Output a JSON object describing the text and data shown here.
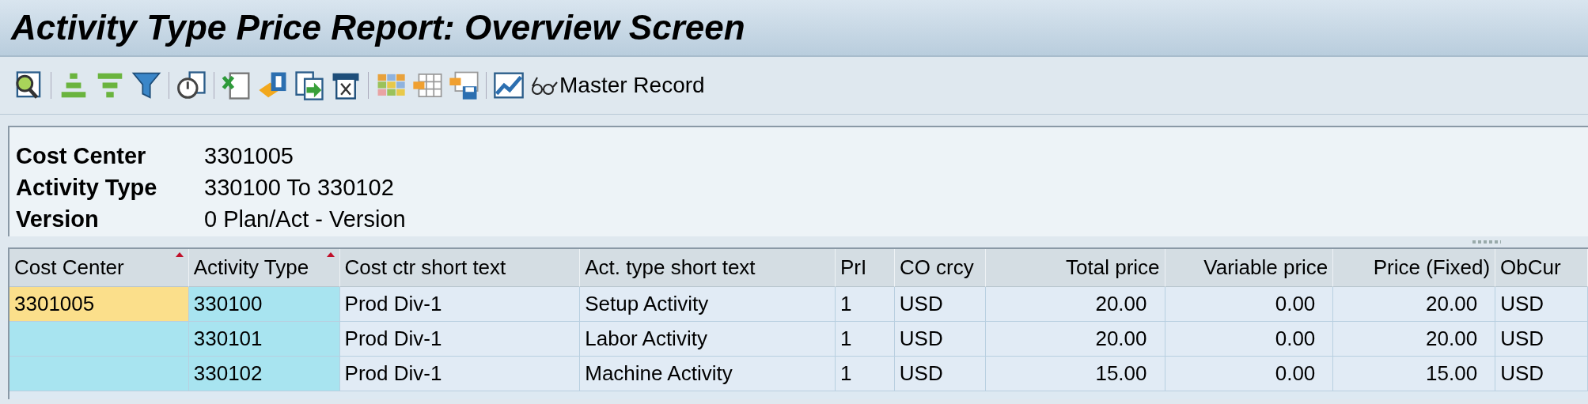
{
  "window": {
    "title": "Activity Type Price Report: Overview Screen"
  },
  "toolbar": {
    "icons": [
      {
        "kind": "details"
      },
      {
        "kind": "sort-up"
      },
      {
        "kind": "sort-down"
      },
      {
        "kind": "filter"
      },
      {
        "kind": "clock"
      },
      {
        "kind": "sheet"
      },
      {
        "kind": "word"
      },
      {
        "kind": "export"
      },
      {
        "kind": "print"
      },
      {
        "kind": "grid"
      },
      {
        "kind": "layout"
      },
      {
        "kind": "save"
      },
      {
        "kind": "chart"
      }
    ],
    "master_record": {
      "label": "Master Record"
    }
  },
  "header": {
    "fields": [
      {
        "label": "Cost Center",
        "value": "3301005"
      },
      {
        "label": "Activity Type",
        "value": "330100 To 330102"
      },
      {
        "label": "Version",
        "value": "0 Plan/Act - Version"
      }
    ]
  },
  "table": {
    "columns": [
      {
        "label": "Cost Center",
        "kind": "key",
        "sorted": true
      },
      {
        "label": "Activity Type",
        "kind": "key",
        "sorted": true
      },
      {
        "label": "Cost ctr short text",
        "kind": "text",
        "sorted": false
      },
      {
        "label": "Act. type short text",
        "kind": "text",
        "sorted": false
      },
      {
        "label": "PrI",
        "kind": "text",
        "sorted": false
      },
      {
        "label": "CO crcy",
        "kind": "text",
        "sorted": false
      },
      {
        "label": "Total price",
        "kind": "number",
        "sorted": false
      },
      {
        "label": "Variable price",
        "kind": "number",
        "sorted": false
      },
      {
        "label": "Price (Fixed)",
        "kind": "number",
        "sorted": false
      },
      {
        "label": "ObCur",
        "kind": "text",
        "sorted": false
      }
    ],
    "rows": [
      {
        "cells": [
          "3301005",
          "330100",
          "Prod Div-1",
          "Setup Activity",
          "1",
          "USD",
          "20.00",
          "0.00",
          "20.00",
          "USD"
        ]
      },
      {
        "cells": [
          "",
          "330101",
          "Prod Div-1",
          "Labor Activity",
          "1",
          "USD",
          "20.00",
          "0.00",
          "20.00",
          "USD"
        ]
      },
      {
        "cells": [
          "",
          "330102",
          "Prod Div-1",
          "Machine Activity",
          "1",
          "USD",
          "15.00",
          "0.00",
          "15.00",
          "USD"
        ]
      }
    ]
  }
}
